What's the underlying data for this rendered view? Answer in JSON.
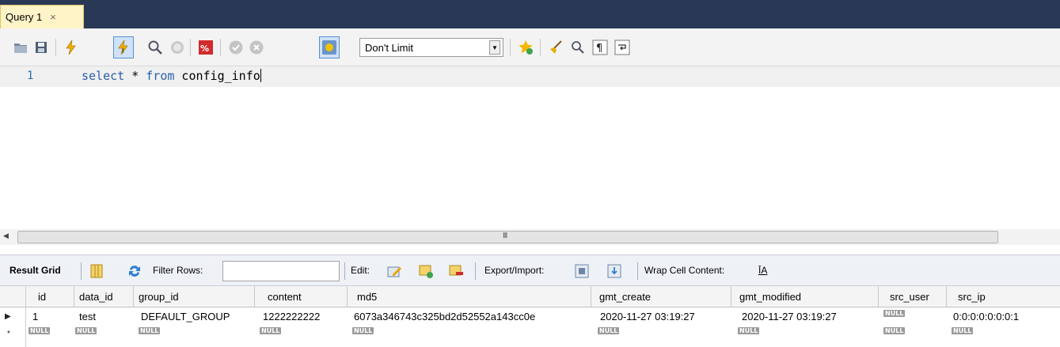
{
  "tab": {
    "label": "Query 1",
    "close": "×"
  },
  "toolbar": {
    "icons": [
      "open-folder-icon",
      "save-icon",
      "execute-icon",
      "execute-current-icon",
      "explain-icon",
      "stop-icon",
      "toggle-stop-on-error-icon",
      "commit-icon",
      "rollback-icon",
      "autocommit-icon",
      "add-snippet-icon",
      "beautify-icon",
      "find-icon",
      "invisible-chars-icon",
      "word-wrap-icon"
    ],
    "limit_value": "Don't Limit",
    "limit_arrow": "▼"
  },
  "editor": {
    "line_number": "1",
    "code_kw1": "select",
    "code_mid": " * ",
    "code_kw2": "from",
    "code_rest": " config_info"
  },
  "scrollbar": {
    "left_arrow": "◀",
    "grip": "III"
  },
  "result_toolbar": {
    "result_grid": "Result Grid",
    "filter_rows": "Filter Rows:",
    "filter_value": "",
    "edit": "Edit:",
    "export_import": "Export/Import:",
    "wrap_cell": "Wrap Cell Content:",
    "wrap_icon_text": "ĪA"
  },
  "grid": {
    "columns": [
      "id",
      "data_id",
      "group_id",
      "content",
      "md5",
      "gmt_create",
      "gmt_modified",
      "src_user",
      "src_ip"
    ],
    "rows": [
      {
        "marker": "▶",
        "cells": [
          "1",
          "test",
          "DEFAULT_GROUP",
          "1222222222",
          "6073a346743c325bd2d52552a143cc0e",
          "2020-11-27 03:19:27",
          "2020-11-27 03:19:27",
          "NULL",
          "0:0:0:0:0:0:0:1"
        ]
      },
      {
        "marker": "*",
        "cells": [
          "NULL",
          "NULL",
          "NULL",
          "NULL",
          "NULL",
          "NULL",
          "NULL",
          "NULL",
          "NULL"
        ]
      }
    ]
  },
  "colors": {
    "tabbar": "#293955",
    "tab_active": "#fff3c8",
    "keyword": "#2a5ea8",
    "line_number": "#2b6fa8"
  }
}
